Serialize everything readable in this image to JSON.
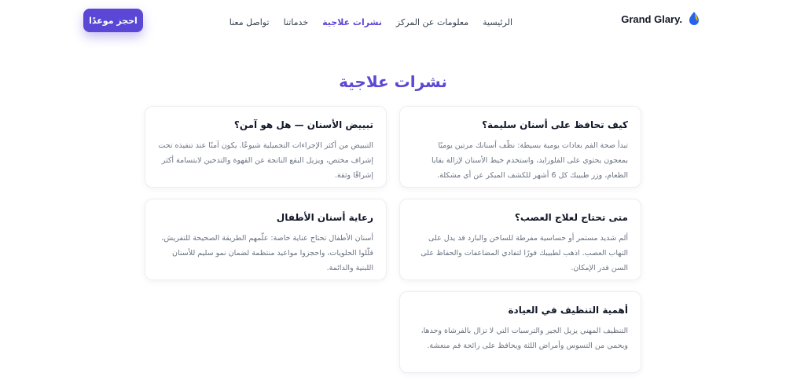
{
  "brand": {
    "name": "Grand Glary.",
    "logo_icon": "tooth-drop-logo"
  },
  "nav": {
    "items": [
      {
        "label": "الرئيسية",
        "active": false
      },
      {
        "label": "معلومات عن المركز",
        "active": false
      },
      {
        "label": "نشرات علاجية",
        "active": true
      },
      {
        "label": "خدماتنا",
        "active": false
      },
      {
        "label": "تواصل معنا",
        "active": false
      }
    ]
  },
  "cta": {
    "label": "احجز موعدًا"
  },
  "section": {
    "title": "نشرات علاجية"
  },
  "cards": [
    {
      "title": "كيف تحافظ على أسنان سليمة؟",
      "text": "تبدأ صحة الفم بعادات يومية بسيطة: نظّف أسنانك مرتين يوميًا بمعجون يحتوي على الفلورايد، واستخدم خيط الأسنان لإزالة بقايا الطعام، وزر طبيبك كل 6 أشهر للكشف المبكر عن أي مشكلة."
    },
    {
      "title": "تبييض الأسنان — هل هو آمن؟",
      "text": "التبييض من أكثر الإجراءات التجميلية شيوعًا. يكون آمنًا عند تنفيذه تحت إشراف مختص، ويزيل البقع الناتجة عن القهوة والتدخين لابتسامة أكثر إشراقًا وثقة."
    },
    {
      "title": "متى تحتاج لعلاج العصب؟",
      "text": "ألم شديد مستمر أو حساسية مفرطة للساخن والبارد قد يدل على التهاب العصب. اذهب لطبيبك فورًا لتفادي المضاعفات والحفاظ على السن قدر الإمكان."
    },
    {
      "title": "رعاية أسنان الأطفال",
      "text": "أسنان الأطفال تحتاج عناية خاصة: علّمهم الطريقة الصحيحة للتفريش، قلّلوا الحلويات، واحجزوا مواعيد منتظمة لضمان نمو سليم للأسنان اللبنية والدائمة."
    },
    {
      "title": "أهمية التنظيف في العيادة",
      "text": "التنظيف المهني يزيل الجير والترسبات التي لا تزال بالفرشاة وحدها، ويحمي من التسوس وأمراض اللثة ويحافظ على رائحة فم منعشة."
    }
  ],
  "colors": {
    "accent": "#5b47d6",
    "logo_blue": "#2563eb",
    "logo_yellow": "#f5b400"
  }
}
